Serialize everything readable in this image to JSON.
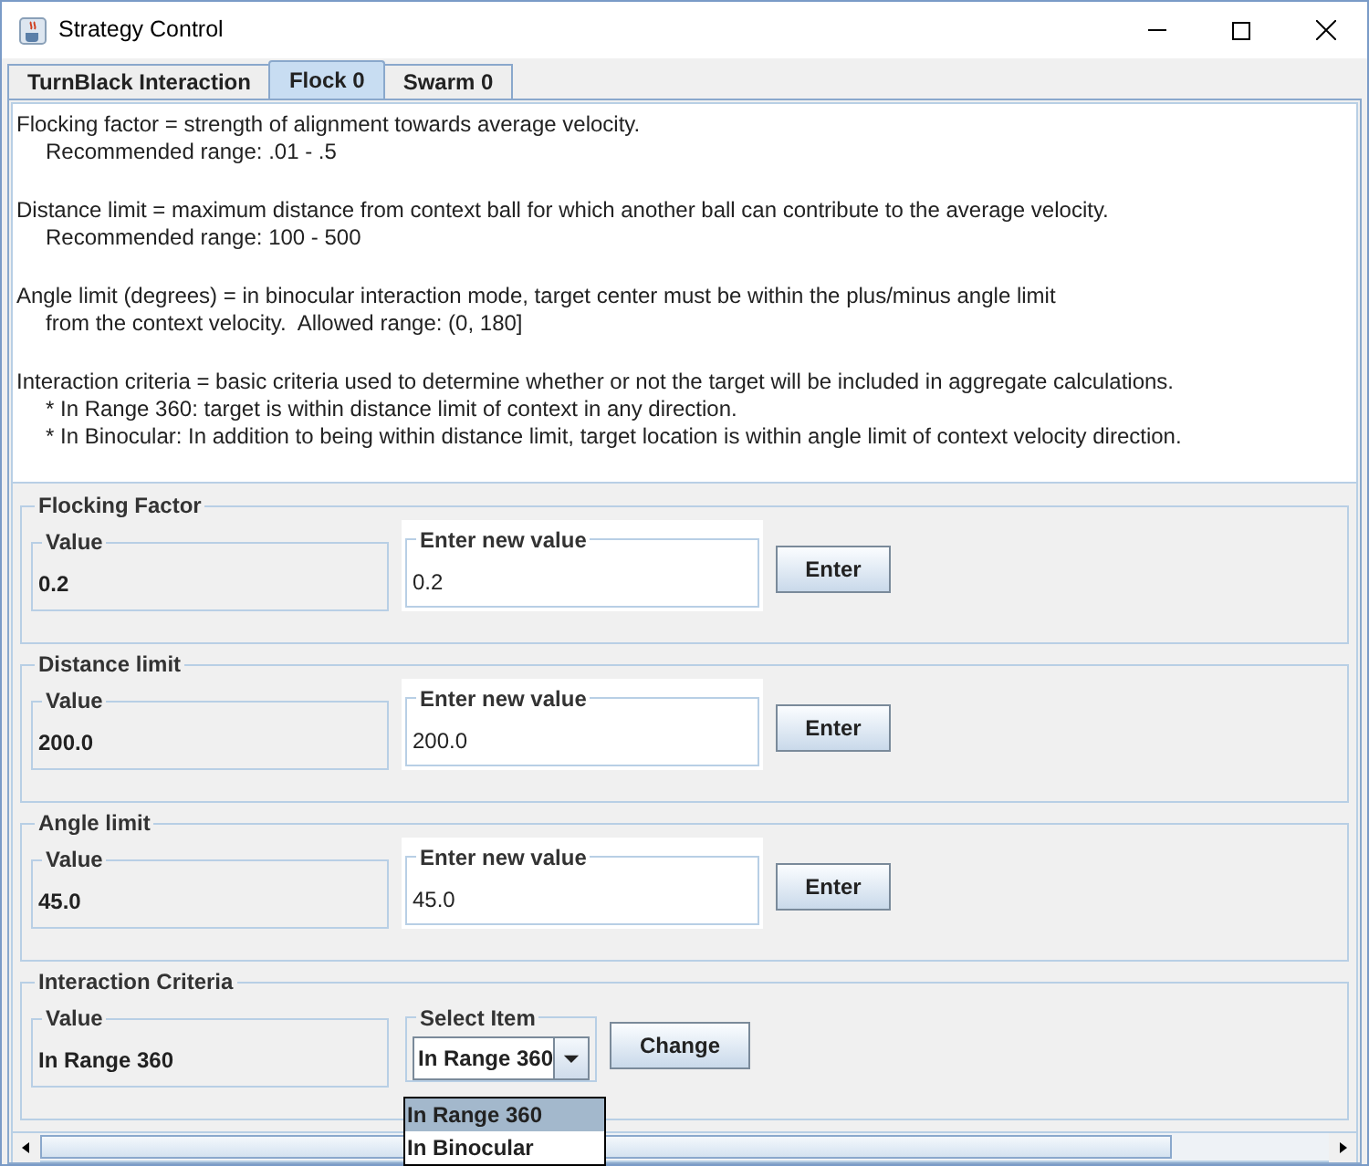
{
  "window": {
    "title": "Strategy Control"
  },
  "tabs": [
    {
      "label": "TurnBlack Interaction",
      "selected": false
    },
    {
      "label": "Flock 0",
      "selected": true
    },
    {
      "label": "Swarm 0",
      "selected": false
    }
  ],
  "description": [
    [
      "Flocking factor = strength of alignment towards average velocity.",
      "Recommended range: .01 - .5"
    ],
    [
      "Distance limit = maximum distance from context ball for which another ball can contribute to the average velocity.",
      "Recommended range: 100 - 500"
    ],
    [
      "Angle limit (degrees) = in binocular interaction mode, target center must be within the plus/minus angle limit",
      "from the context velocity.  Allowed range: (0, 180]"
    ],
    [
      "Interaction criteria = basic criteria used to determine whether or not the target will be included in aggregate calculations.",
      "* In Range 360: target is within distance limit of context in any direction.",
      "* In Binocular: In addition to being within distance limit, target location is within angle limit of context velocity direction."
    ]
  ],
  "sections": [
    {
      "kind": "field",
      "title": "Flocking Factor",
      "value_label": "Value",
      "value": "0.2",
      "input_label": "Enter new value",
      "input_value": "0.2",
      "button": "Enter"
    },
    {
      "kind": "field",
      "title": "Distance limit",
      "value_label": "Value",
      "value": "200.0",
      "input_label": "Enter new value",
      "input_value": "200.0",
      "button": "Enter"
    },
    {
      "kind": "field",
      "title": "Angle limit",
      "value_label": "Value",
      "value": "45.0",
      "input_label": "Enter new value",
      "input_value": "45.0",
      "button": "Enter"
    },
    {
      "kind": "select",
      "title": "Interaction Criteria",
      "value_label": "Value",
      "value": "In Range 360",
      "select_label": "Select Item",
      "select_value": "In Range 360",
      "expanded": true,
      "button": "Change",
      "options": [
        {
          "label": "In Range 360",
          "selected": true
        },
        {
          "label": "In Binocular",
          "selected": false
        }
      ]
    }
  ]
}
